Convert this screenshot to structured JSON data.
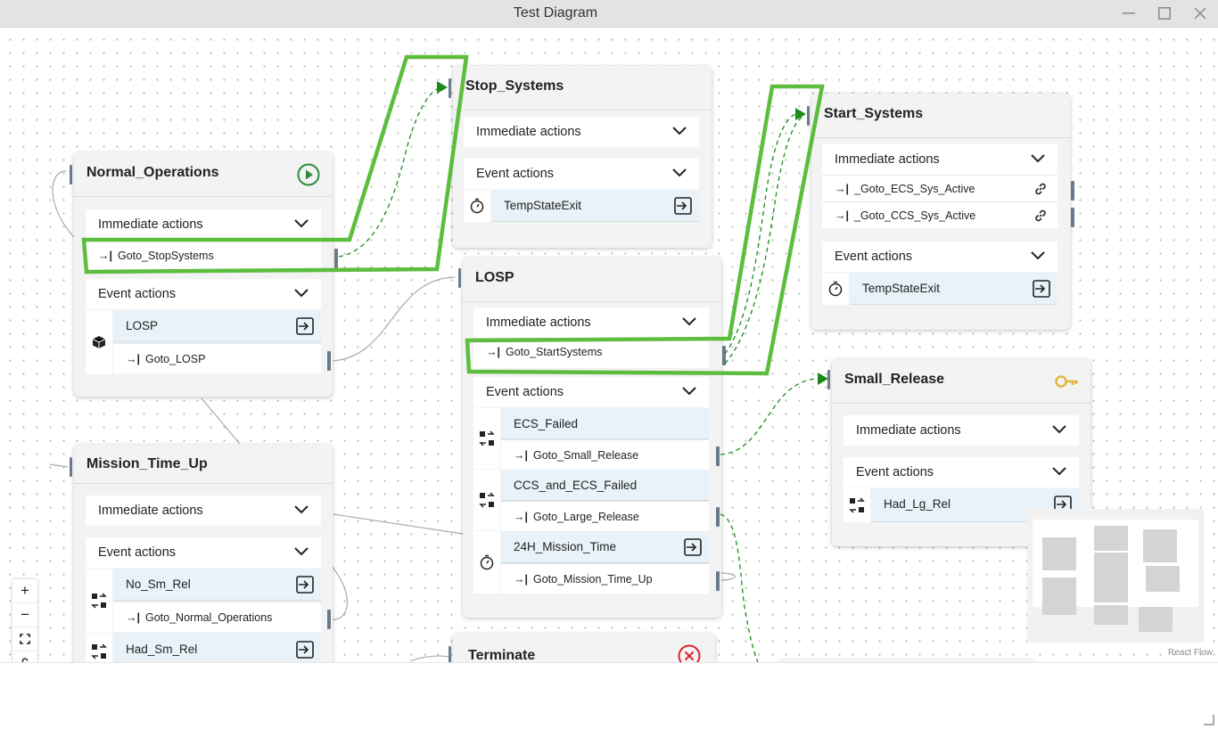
{
  "window": {
    "title": "Test Diagram"
  },
  "labels": {
    "immediate_actions": "Immediate actions",
    "event_actions": "Event actions"
  },
  "icons": {
    "arrow": "→|",
    "start": "play-circle-icon",
    "terminate": "x-circle-icon",
    "small_release": "key-icon",
    "exit": "exit-icon",
    "link": "link-icon",
    "timer": "stopwatch-icon",
    "dice": "cube-icon",
    "swap": "swap-icon"
  },
  "colors": {
    "highlight": "#5cbd3e",
    "green_edge": "#1b8a1b",
    "handle": "#6b7a8a",
    "start": "#2e8b3a",
    "terminate": "#d9262b",
    "key": "#e2b93b"
  },
  "nodes": {
    "normal_operations": {
      "title": "Normal_Operations",
      "immediate": [
        "Goto_StopSystems"
      ],
      "event": "LOSP",
      "event_action": "Goto_LOSP"
    },
    "stop_systems": {
      "title": "Stop_Systems",
      "event": "TempStateExit"
    },
    "start_systems": {
      "title": "Start_Systems",
      "immediate": [
        "_Goto_ECS_Sys_Active",
        "_Goto_CCS_Sys_Active"
      ],
      "event": "TempStateExit"
    },
    "losp": {
      "title": "LOSP",
      "immediate": [
        "Goto_StartSystems"
      ],
      "events": [
        {
          "name": "ECS_Failed",
          "action": "Goto_Small_Release"
        },
        {
          "name": "CCS_and_ECS_Failed",
          "action": "Goto_Large_Release"
        },
        {
          "name": "24H_Mission_Time",
          "action": "Goto_Mission_Time_Up"
        }
      ]
    },
    "small_release": {
      "title": "Small_Release",
      "event": "Had_Lg_Rel"
    },
    "mission_time_up": {
      "title": "Mission_Time_Up",
      "events": [
        {
          "name": "No_Sm_Rel",
          "action": "Goto_Normal_Operations"
        },
        {
          "name": "Had_Sm_Rel"
        }
      ]
    },
    "terminate": {
      "title": "Terminate"
    }
  },
  "controls": {
    "zoom_in": "+",
    "zoom_out": "−",
    "fit": "⛶",
    "lock": "🔒"
  },
  "attribution": "React Flow"
}
